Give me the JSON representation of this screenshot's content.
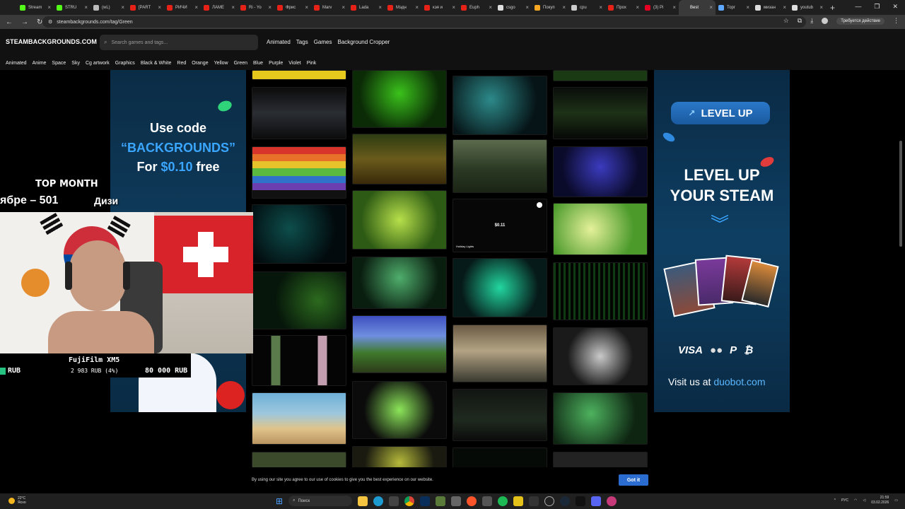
{
  "browser": {
    "tabs": [
      {
        "label": "Stream",
        "color": "#53fc18"
      },
      {
        "label": "STRU",
        "color": "#53fc18"
      },
      {
        "label": "(wL)",
        "color": "#bbbbbb"
      },
      {
        "label": "[PART",
        "color": "#e62117"
      },
      {
        "label": "РИЧИ",
        "color": "#e62117"
      },
      {
        "label": "ЛАМЕ",
        "color": "#e62117"
      },
      {
        "label": "Ri - Yo",
        "color": "#e62117"
      },
      {
        "label": "Фрис",
        "color": "#e62117"
      },
      {
        "label": "Marv",
        "color": "#e62117"
      },
      {
        "label": "Lada",
        "color": "#e62117"
      },
      {
        "label": "Мэдн",
        "color": "#e62117"
      },
      {
        "label": "кэя и",
        "color": "#e62117"
      },
      {
        "label": "Euph",
        "color": "#e62117"
      },
      {
        "label": "csgo",
        "color": "#dddddd"
      },
      {
        "label": "Покуп",
        "color": "#f5a623"
      },
      {
        "label": "cpu",
        "color": "#cccccc"
      },
      {
        "label": "Прох",
        "color": "#e62117"
      },
      {
        "label": "(3) Pi",
        "color": "#e60023"
      },
      {
        "label": "Best",
        "color": "#3a3a3a",
        "active": true
      },
      {
        "label": "Торг",
        "color": "#5fa8ff"
      },
      {
        "label": "мизан",
        "color": "#dddddd"
      },
      {
        "label": "youtub",
        "color": "#dddddd"
      }
    ],
    "url": "steambackgrounds.com/tag/Green",
    "update_label": "Требуется действие"
  },
  "site": {
    "logo": "STEAMBACKGROUNDS.COM",
    "search_placeholder": "Search games and tags...",
    "nav": [
      "Animated",
      "Tags",
      "Games",
      "Background Cropper"
    ],
    "tags": [
      "Animated",
      "Anime",
      "Space",
      "Sky",
      "Cg artwork",
      "Graphics",
      "Black & White",
      "Red",
      "Orange",
      "Yellow",
      "Green",
      "Blue",
      "Purple",
      "Violet",
      "Pink"
    ]
  },
  "ad_left": {
    "line1": "Use code",
    "line2": "“BACKGROUNDS”",
    "line3_prefix": "For ",
    "line3_price": "$0.10",
    "line3_suffix": " free"
  },
  "ad_right": {
    "button": "LEVEL UP",
    "title_line1": "LEVEL UP",
    "title_line2": "YOUR STEAM",
    "payments": [
      "VISA",
      "●●",
      "P",
      "₿"
    ],
    "visit_prefix": "Visit us at ",
    "visit_site": "duobot.com"
  },
  "grid": {
    "featured_price": "$0.11",
    "featured_caption": "Holiday Lights"
  },
  "stream_overlay": {
    "top_month": "TOP MONTH",
    "rank_line": "ябре – 501",
    "rank_right": "Дизи",
    "goal_title": "FujiFilm XM5",
    "goal_current": "RUB",
    "goal_progress": "2 983 RUB (4%)",
    "goal_target": "80 000 RUB"
  },
  "cookie": {
    "text": "By using our site you agree to our use of cookies to give you the best experience on our website.",
    "button": "Got it"
  },
  "taskbar": {
    "weather_temp": "22°C",
    "weather_desc": "Ясно",
    "search_label": "Поиск",
    "lang": "РУС",
    "time": "21:59",
    "date": "03.02.2026"
  }
}
